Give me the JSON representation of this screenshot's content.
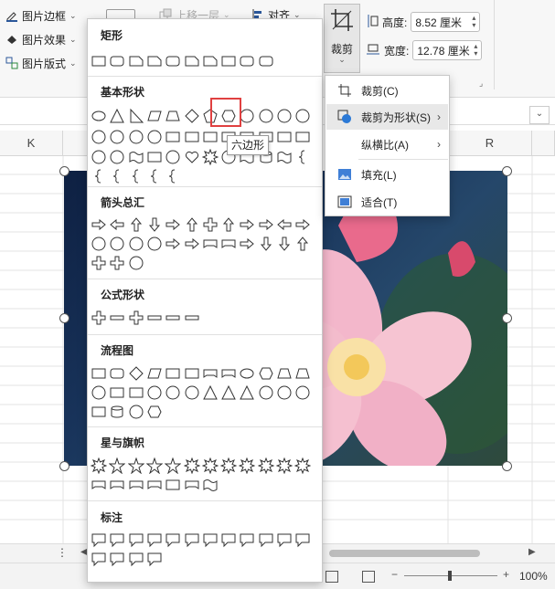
{
  "ribbon": {
    "picture_border": "图片边框",
    "picture_effects": "图片效果",
    "picture_layout": "图片版式",
    "bring_forward": "上移一层",
    "align": "对齐",
    "crop": "裁剪",
    "height_label": "高度:",
    "height_value": "8.52 厘米",
    "width_label": "宽度:",
    "width_value": "12.78 厘米"
  },
  "columns": [
    "K",
    "R"
  ],
  "shape_menu": {
    "sections": [
      "矩形",
      "基本形状",
      "箭头总汇",
      "公式形状",
      "流程图",
      "星与旗帜",
      "标注"
    ],
    "tooltip": "六边形"
  },
  "crop_menu": {
    "items": [
      {
        "label": "裁剪(C)",
        "icon": "crop-icon"
      },
      {
        "label": "裁剪为形状(S)",
        "icon": "shape-crop-icon",
        "submenu": true
      },
      {
        "label": "纵横比(A)",
        "icon": "",
        "submenu": true
      },
      {
        "label": "填充(L)",
        "icon": "fill-icon"
      },
      {
        "label": "适合(T)",
        "icon": "fit-icon"
      }
    ]
  },
  "status": {
    "zoom": "100%"
  },
  "colors": {
    "accent": "#2b579a",
    "highlight": "#e04040"
  }
}
